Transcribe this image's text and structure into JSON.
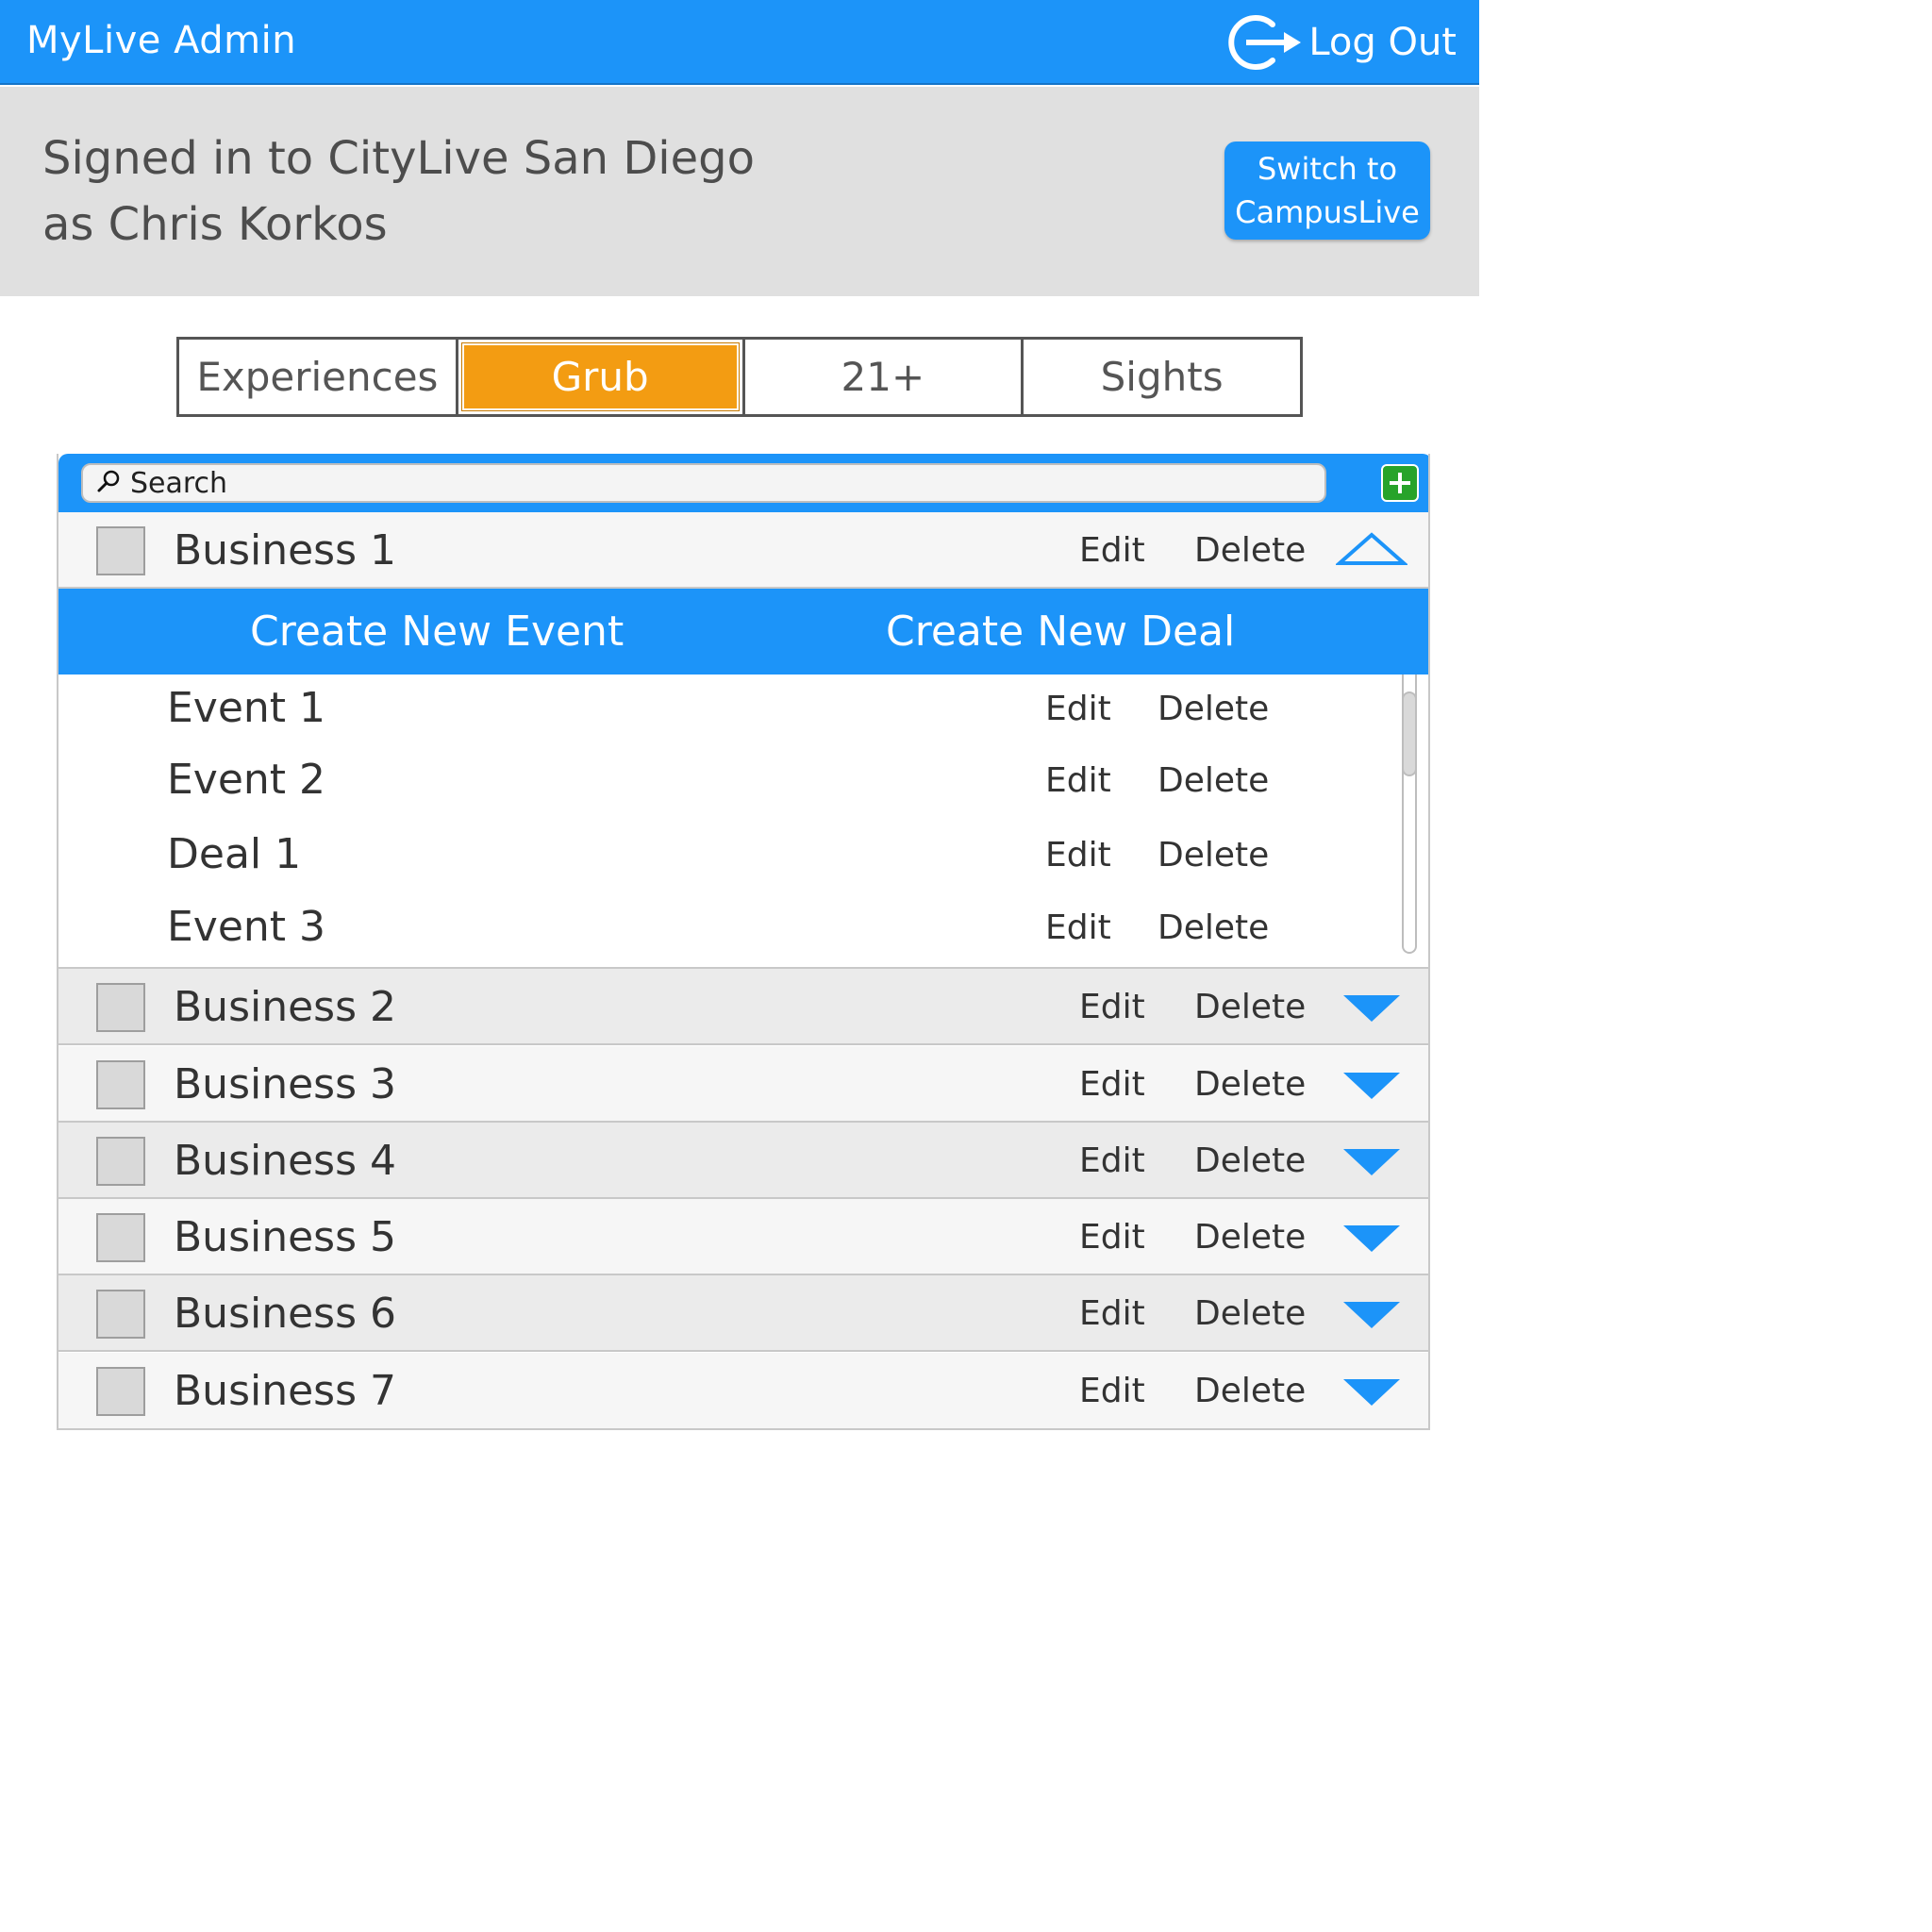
{
  "header": {
    "app_title": "MyLive Admin",
    "logout_label": "Log Out",
    "logout_icon": "logout-arrow-icon",
    "accent_color": "#1c94f9"
  },
  "signin": {
    "line1": "Signed in to CityLive San Diego",
    "line2": "as Chris Korkos",
    "switch_button": [
      "Switch to",
      "CampusLive"
    ]
  },
  "tabs": [
    {
      "label": "Experiences",
      "active": false
    },
    {
      "label": "Grub",
      "active": true
    },
    {
      "label": "21+",
      "active": false
    },
    {
      "label": "Sights",
      "active": false
    }
  ],
  "active_tab_color": "#f39c12",
  "search": {
    "placeholder": "Search",
    "icon": "magnifier-icon",
    "add_icon": "plus-icon",
    "add_color": "#27a32a"
  },
  "actions": {
    "edit": "Edit",
    "delete": "Delete"
  },
  "expanded": {
    "business": "Business 1",
    "create_event": "Create New Event",
    "create_deal": "Create New Deal",
    "items": [
      "Event 1",
      "Event 2",
      "Deal 1",
      "Event 3"
    ],
    "toggle_icon": "chevron-up-outline-icon"
  },
  "businesses": [
    "Business 2",
    "Business 3",
    "Business 4",
    "Business 5",
    "Business 6",
    "Business 7"
  ],
  "collapsed_toggle_icon": "triangle-down-icon"
}
